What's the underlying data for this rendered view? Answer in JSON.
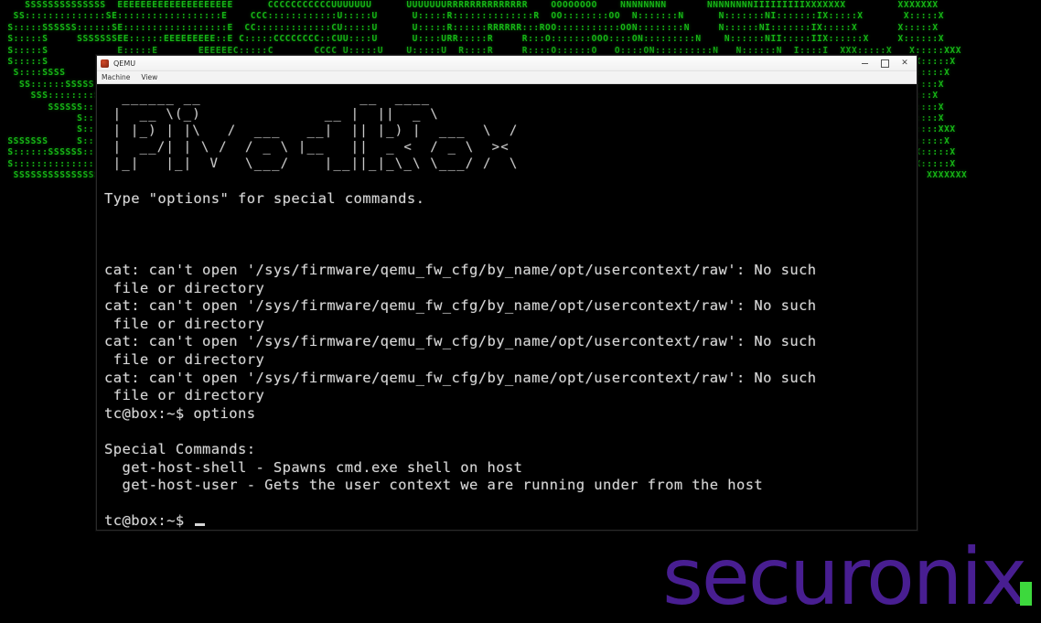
{
  "background": {
    "kind": "ascii-art-banner",
    "word": "SECURONIX",
    "color": "#17b517",
    "art_lines": [
      "    SSSSSSSSSSSSSS  EEEEEEEEEEEEEEEEEEEE      CCCCCCCCCCCUUUUUUU      UUUUUUURRRRRRRRRRRRRR    OOOOOOOO    NNNNNNNN       NNNNNNNNIIIIIIIIIXXXXXXX         XXXXXXX",
      "  SS::::::::::::::SE::::::::::::::::::E    CCC::::::::::::U:::::U      U:::::R::::::::::::::R  OO::::::::OO  N:::::::N      N:::::::NI:::::::IX:::::X       X:::::X",
      " S:::::SSSSSS::::::SE::::::::::::::::::E  CC:::::::::::::CU:::::U      U:::::R::::::RRRRRR:::ROO:::::::::::OON::::::::N     N::::::NI:::::::IX:::::X       X:::::X",
      " S:::::S     SSSSSSSEE::::::EEEEEEEEE::E C:::::CCCCCCCC::CUU::::U      U::::URR:::::R     R:::O:::::::OOO::::ON:::::::::N    N::::::NII:::::IIX::::::X     X::::::X",
      " S:::::S            E:::::E       EEEEEEC:::::C       CCCC U:::::U    U:::::U  R::::R     R::::O::::::O   O::::ON::::::::::N   N::::::N  I::::I  XXX:::::X   X:::::XXX",
      " S:::::S            E:::::E            C:::::C              U:::::U    U:::::U  R::::R     R::::O:::::O     O:::::N:::::::::::N  N::::::N  I::::I     X:::::X X:::::X",
      "  S::::SSSS         E::::::EEEEEEEEEE  C:::::C              U:::::U    U:::::U  R::::RRRRRR:::::O:::::O     O:::::N:::::::N::::N N::::::N  I::::I      X:::::X:::::X",
      "   SS::::::SSSSS    E:::::::::::::::E  C:::::C              U:::::U    U:::::U  R:::::::::::::RRO:::::O     O:::::N::::::N N::::N N:::::N  I::::I       X:::::::::X",
      "     SSS::::::::SS  E:::::::::::::::E  C:::::C              U:::::U    U:::::U  R::::RRRRRR:::::O:::::O     O:::::N::::::N  N::::N:::::N  I::::I       X:::::::::X",
      "        SSSSSS::::S E::::::EEEEEEEEEE  C:::::C              U:::::U    U:::::U  R::::R     R::::O:::::O     O:::::N::::::N   N:::::::::N  I::::I      X:::::X:::::X",
      "             S:::::SE:::::E             C:::::C             U:::::D    D:::::U  R::::R     R::::O::::::O   O::::ON::::::N    N::::::::N  I::::I     X:::::X X:::::X",
      "             S:::::SE:::::E       EEEEEE C:::::C       CCCC U::::::U  U::::::U  R::::R     R::::O:::::::OOO::::ON::::::N     N:::::::N  I::::I  XXX:::::X   X:::::XXX",
      " SSSSSSS     S:::::EE::::::EEEEEEEE:::::E C:::::CCCCCCCC::C U:::::::UU:::::::URR:::::R     R:::R OO:::::::::::OON::::::N      N::::::NII:::::IIX::::::X     X::::::X",
      " S::::::SSSSSS:::::SE::::::::::::::::::E   CC:::::::::::::C  UU:::::::::::::UU R::::::R     R::::R OO:::::::::OO N::::::N       N:::::NI:::::::IX:::::X       X:::::X",
      " S:::::::::::::::SS E::::::::::::::::::E     CCC::::::::::C    UU:::::::::UU   R::::::R     R::::R   OO:::::OO   N::::::N        N::::NI:::::::IX:::::X       X:::::X",
      "  SSSSSSSSSSSSSSS   EEEEEEEEEEEEEEEEEEEE        CCCCCCCCC        UUUUUUUUU     RRRRRRRR     RRRRRR     OOOOO     NNNNNNNN         NNNNNIIIIIIIIIXXXXXXX         XXXXXXX"
    ]
  },
  "watermark": {
    "text": "securonix",
    "color": "#4b1f96",
    "accent_color": "#3fe03f"
  },
  "window": {
    "title": "QEMU",
    "icon": "qemu-app-icon",
    "controls": {
      "minimize_label": "minimize",
      "maximize_label": "maximize",
      "close_label": "✕"
    },
    "menus": [
      {
        "label": "Machine"
      },
      {
        "label": "View"
      }
    ]
  },
  "terminal": {
    "logo_art": [
      "  ______ __                  __  ____                ",
      " |  __ \\(_)              __ |  ||  _ \\               ",
      " | |_) | |\\   /  ___   __|  || |_) |  ___  \\  /      ",
      " |  __/| | \\ /  / _ \\ |__   ||  _ <  / _ \\  ><       ",
      " |_|   |_|  V   \\___/    |__||_|_\\_\\ \\___/ /  \\      "
    ],
    "logo_art_text": "PivotBox",
    "intro_line": "Type \"options\" for special commands.",
    "error_line_1": "cat: can't open '/sys/firmware/qemu_fw_cfg/by_name/opt/usercontext/raw': No such",
    "error_line_2": " file or directory",
    "error_repeat_count": 4,
    "prompt_options": "tc@box:~$ options",
    "special_commands_header": "Special Commands:",
    "command_1": "  get-host-shell - Spawns cmd.exe shell on host",
    "command_2": "  get-host-user - Gets the user context we are running under from the host",
    "prompt_final": "tc@box:~$ ",
    "cursor": "_"
  }
}
